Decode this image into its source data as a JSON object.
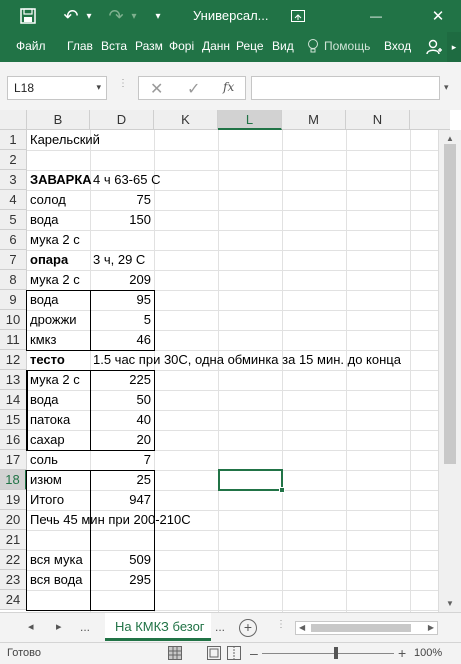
{
  "titlebar": {
    "title": "Универсал...",
    "undo_symbol": "↶",
    "redo_symbol": "↷",
    "dropdown_symbol": "▾",
    "min_symbol": "—",
    "close_symbol": "✕"
  },
  "ribbon": {
    "tabs": [
      "Файл",
      "Глав",
      "Вста",
      "Разм",
      "Форі",
      "Данн",
      "Реце",
      "Вид"
    ],
    "help_label": "Помощь",
    "signin_label": "Вход",
    "scroll_symbol": "▸"
  },
  "formula_bar": {
    "name_box": "L18",
    "name_box_arrow": "▾",
    "cancel_symbol": "✕",
    "enter_symbol": "✓",
    "fx_label": "fx",
    "formula_value": "",
    "expand_symbol": "▾"
  },
  "columns": [
    "B",
    "D",
    "K",
    "L",
    "M",
    "N"
  ],
  "selected_column": "L",
  "selected_row": "18",
  "rows": [
    {
      "n": "1",
      "b": "Карельский",
      "d": ""
    },
    {
      "n": "2",
      "b": "",
      "d": ""
    },
    {
      "n": "3",
      "b": "ЗАВАРКА",
      "d": "4 ч 63-65 С"
    },
    {
      "n": "4",
      "b": "солод",
      "d": "75"
    },
    {
      "n": "5",
      "b": "вода",
      "d": "150"
    },
    {
      "n": "6",
      "b": "мука 2 с",
      "d": ""
    },
    {
      "n": "7",
      "b": "опара",
      "d": "3 ч, 29 С"
    },
    {
      "n": "8",
      "b": "мука 2 с",
      "d": "209"
    },
    {
      "n": "9",
      "b": "вода",
      "d": "95"
    },
    {
      "n": "10",
      "b": "дрожжи",
      "d": "5"
    },
    {
      "n": "11",
      "b": "кмкз",
      "d": "46"
    },
    {
      "n": "12",
      "b": "тесто",
      "d": "1.5 час при 30С, одна обминка за 15 мин. до конца"
    },
    {
      "n": "13",
      "b": "мука 2 с",
      "d": "225"
    },
    {
      "n": "14",
      "b": "вода",
      "d": "50"
    },
    {
      "n": "15",
      "b": "патока",
      "d": "40"
    },
    {
      "n": "16",
      "b": "сахар",
      "d": "20"
    },
    {
      "n": "17",
      "b": "соль",
      "d": "7"
    },
    {
      "n": "18",
      "b": "изюм",
      "d": "25"
    },
    {
      "n": "19",
      "b": "Итого",
      "d": "947"
    },
    {
      "n": "20",
      "b": "Печь 45 мин при 200-210С",
      "d": ""
    },
    {
      "n": "21",
      "b": "",
      "d": ""
    },
    {
      "n": "22",
      "b": "вся мука",
      "d": "509"
    },
    {
      "n": "23",
      "b": "вся вода",
      "d": "295"
    },
    {
      "n": "24",
      "b": "",
      "d": ""
    }
  ],
  "sheets": {
    "nav_prev": "◂",
    "nav_next": "▸",
    "nav_more": "...",
    "active_tab": "На КМКЗ безог",
    "more_after": "...",
    "add_symbol": "+"
  },
  "status": {
    "text": "Готово",
    "zoom_minus": "–",
    "zoom_plus": "+",
    "zoom": "100%",
    "zoom_level_percent": 100
  },
  "colors": {
    "accent": "#217346",
    "header_bg": "#efefef",
    "gridline": "#e1e1e1"
  }
}
